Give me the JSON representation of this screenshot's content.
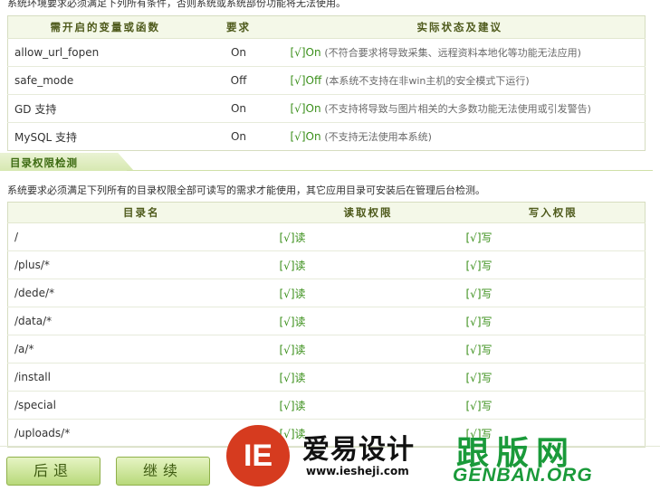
{
  "intro_text": "系统环境要求必须满足下列所有条件，否则系统或系统部份功能将无法使用。",
  "env_table": {
    "headers": [
      "需开启的变量或函数",
      "要求",
      "实际状态及建议"
    ],
    "rows": [
      {
        "name": "allow_url_fopen",
        "required": "On",
        "status": "[√]On",
        "note": "(不符合要求将导致采集、远程资料本地化等功能无法应用)"
      },
      {
        "name": "safe_mode",
        "required": "Off",
        "status": "[√]Off",
        "note": "(本系统不支持在非win主机的安全模式下运行)"
      },
      {
        "name": "GD 支持",
        "required": "On",
        "status": "[√]On",
        "note": "(不支持将导致与图片相关的大多数功能无法使用或引发警告)"
      },
      {
        "name": "MySQL 支持",
        "required": "On",
        "status": "[√]On",
        "note": "(不支持无法使用本系统)"
      }
    ]
  },
  "section_title": "目录权限检测",
  "section_desc": "系统要求必须满足下列所有的目录权限全部可读写的需求才能使用，其它应用目录可安装后在管理后台检测。",
  "dir_table": {
    "headers": [
      "目录名",
      "读取权限",
      "写入权限"
    ],
    "rows": [
      {
        "dir": "/",
        "read": "[√]读",
        "write": "[√]写"
      },
      {
        "dir": "/plus/*",
        "read": "[√]读",
        "write": "[√]写"
      },
      {
        "dir": "/dede/*",
        "read": "[√]读",
        "write": "[√]写"
      },
      {
        "dir": "/data/*",
        "read": "[√]读",
        "write": "[√]写"
      },
      {
        "dir": "/a/*",
        "read": "[√]读",
        "write": "[√]写"
      },
      {
        "dir": "/install",
        "read": "[√]读",
        "write": "[√]写"
      },
      {
        "dir": "/special",
        "read": "[√]读",
        "write": "[√]写"
      },
      {
        "dir": "/uploads/*",
        "read": "[√]读",
        "write": "[√]写"
      }
    ]
  },
  "buttons": {
    "back": "后退",
    "continue": "继续"
  },
  "watermarks": {
    "ie_logo": "IE",
    "ie_name": "爱易设计",
    "ie_url": "www.iesheji.com",
    "genban_cn": "跟版网",
    "genban_en": "GENBAN.ORG"
  },
  "colors": {
    "accent_green": "#3a8f1a",
    "header_bg": "#f4f8e8",
    "watermark_red": "#d63b1f",
    "watermark_green": "#1a9a3a"
  }
}
